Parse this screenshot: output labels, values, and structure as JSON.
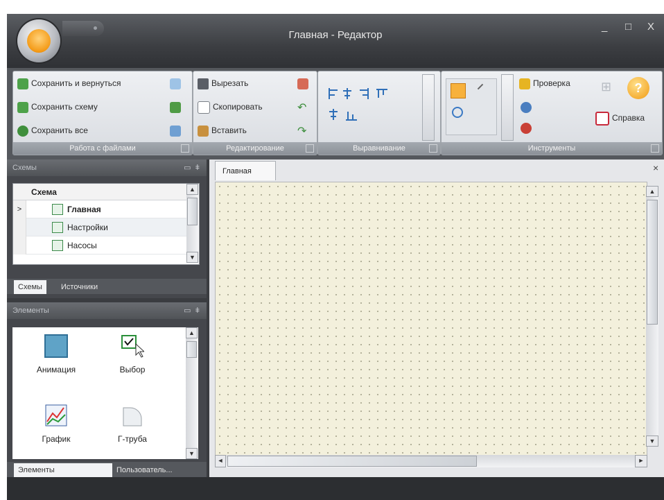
{
  "window": {
    "title": "Главная - Редактор",
    "controls": [
      "_",
      "□",
      "X"
    ]
  },
  "ribbon": {
    "groups": [
      {
        "caption": "Работа с файлами",
        "items": [
          "Сохранить и вернуться",
          "Сохранить схему",
          "Сохранить все"
        ]
      },
      {
        "caption": "Редактирование",
        "items": [
          "Вырезать",
          "Скопировать",
          "Вставить"
        ]
      },
      {
        "caption": "Выравнивание"
      },
      {
        "caption": "Инструменты",
        "items": [
          "Проверка",
          "Справка"
        ]
      }
    ]
  },
  "schemes_panel": {
    "title": "Схемы",
    "column": "Схема",
    "rows": [
      "Главная",
      "Настройки",
      "Насосы"
    ],
    "tabs": [
      "Схемы",
      "Источники"
    ]
  },
  "elements_panel": {
    "title": "Элементы",
    "items": [
      "Анимация",
      "Выбор",
      "График",
      "Г-труба"
    ],
    "tabs": [
      "Элементы",
      "Пользователь..."
    ]
  },
  "document": {
    "tab": "Главная",
    "close": "×"
  },
  "colors": {
    "frame": "#3a3c40",
    "ribbon_group": "#e6e8ec",
    "canvas": "#f3f0dc",
    "accent": "#f49a16"
  }
}
